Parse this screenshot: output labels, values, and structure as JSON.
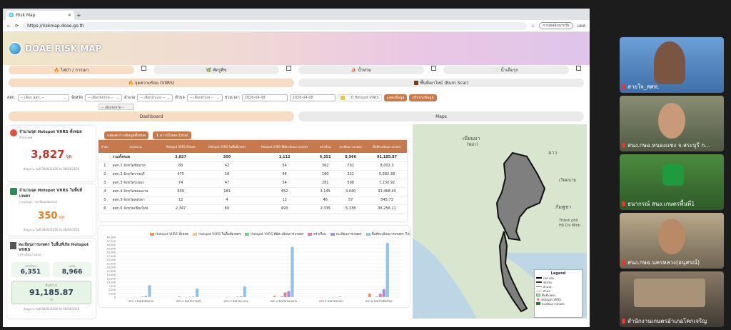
{
  "browser": {
    "tab_title": "Risk Map",
    "url": "https://riskmap.doae.go.th",
    "profile": "การเผลอิกนาถวัย",
    "other": "แหล"
  },
  "app": {
    "logo_text": "DOAE RISK MAP"
  },
  "hazard_tabs": [
    {
      "label": "🔥 ไฟป่า / การเผา"
    },
    {
      "label": "🌿 ศัตรูพืช"
    },
    {
      "label": "⛵ น้ำท่วม"
    },
    {
      "label": "🥛 น้ำเค็มรุก"
    }
  ],
  "sub_tabs": {
    "viirs": "🔥 จุดความร้อน (VIIRS)",
    "burn_scar": "พื้นที่เผาไหม้ (Burn Scar)"
  },
  "filters": {
    "office_label": "สสก.",
    "office_value": "-- เลือก สสก. --",
    "province_label": "จังหวัด",
    "province_value": "-- เลือกจังหวัด --",
    "district_label": "อำเภอ",
    "district_value": "-- เลือกอำเภอ --",
    "subdistrict_label": "ตำบล",
    "subdistrict_value": "-- เลือกตำบล --",
    "period_label": "ช่วงเวลา",
    "date_from": "2026-04-08",
    "date_to": "2026-04-08",
    "hotspot_toggle": "มี Hotspot VIIRS",
    "show_button": "แสดงข้อมูล",
    "refresh_button": "ปรับปรุงข้อมูล",
    "dropdown_option": "-- เลือกจังหวัด --"
  },
  "view_tabs": {
    "dashboard": "Dashboard",
    "maps": "Maps"
  },
  "stats": {
    "hotspot_all_title": "จำนวนจุด Hotspot VIIRS ทั้งหมด",
    "hotspot_all_sub": "ทั่วประเทศ",
    "hotspot_all_value": "3,827",
    "hotspot_all_unit": "จุด",
    "hotspot_all_note": "ข้อมูล ณ วันที่ 08/04/2026 ถึง 08/04/2026",
    "hotspot_farm_title": "จำนวนจุด Hotspot VIIRS ในพื้นที่เกษตร",
    "hotspot_farm_sub": "(ระบบปลูก / ทะเบียนเกษตรกร)",
    "hotspot_farm_value": "350",
    "hotspot_farm_unit": "จุด",
    "hotspot_farm_note": "ข้อมูล ณ วันที่ 08/04/2026 ถึง 08/04/2026",
    "farmer_title": "ทะเบียนการเกษตร ในพื้นที่เกิด Hotspot VIIRS",
    "farmer_sub": "(ครัวเรือน / แปลง)",
    "households_label": "ครัวเรือน",
    "households_value": "6,351",
    "plots_label": "แปลง",
    "plots_value": "8,966",
    "area_label": "พื้นที่ (ไร่)",
    "area_value": "91,185.87",
    "area_unit": "ไร่",
    "farmer_note": "ข้อมูล ณ วันที่ 08/04/2026 ถึง 08/04/2026"
  },
  "table": {
    "btn_show_all": "แสดงตารางข้อมูลทั้งหมด",
    "btn_export": "⬇ ดาวน์โหลด Excel",
    "headers": [
      "ลำดับ",
      "หน่วยงาน",
      "Hotspot VIIRS ทั้งหมด",
      "Hotspot VIIRS ในพื้นที่เกษตร",
      "Hotspot VIIRS ที่มีทะเบียนการเกษตร",
      "ครัวเรือน",
      "ทะเบียนการเกษตร",
      "พื้นที่ทะเบียนการเกษตร"
    ],
    "rows": [
      [
        "",
        "รวมทั้งหมด",
        "3,827",
        "350",
        "1,112",
        "6,351",
        "8,966",
        "91,185.87"
      ],
      [
        "1",
        "สสก.1 จังหวัดชัยนาท",
        "80",
        "42",
        "54",
        "362",
        "702",
        "8,002.3"
      ],
      [
        "2",
        "สสก.2 จังหวัดราชบุรี",
        "475",
        "18",
        "46",
        "180",
        "321",
        "5,682.38"
      ],
      [
        "3",
        "สสก.3 จังหวัดระยอง",
        "74",
        "47",
        "54",
        "281",
        "508",
        "7,230.92"
      ],
      [
        "4",
        "สสก.4 จังหวัดขอนแก่น",
        "839",
        "181",
        "452",
        "3,145",
        "4,040",
        "33,468.43"
      ],
      [
        "5",
        "สสก.5 จังหวัดสงขลา",
        "12",
        "4",
        "13",
        "46",
        "57",
        "545.73"
      ],
      [
        "6",
        "สสก.6 จังหวัดเชียงใหม่",
        "2,347",
        "60",
        "493",
        "2,335",
        "5,338",
        "36,256.11"
      ]
    ]
  },
  "chart_data": {
    "type": "bar",
    "categories": [
      "สสก.1 จังหวัดชัยนาท",
      "สสก.2 จังหวัดราชบุรี",
      "สสก.3 จังหวัดระยอง",
      "สสก.4 จังหวัดขอนแก่น",
      "สสก.5 จังหวัดสงขลา",
      "สสก.6 จังหวัดเชียงใหม่"
    ],
    "series": [
      {
        "name": "Hotspot VIIRS ทั้งหมด",
        "color": "#e8956b",
        "values": [
          80,
          475,
          74,
          839,
          12,
          2347
        ]
      },
      {
        "name": "Hotspot VIIRS ในพื้นที่เกษตร",
        "color": "#f2c29a",
        "values": [
          42,
          18,
          47,
          181,
          4,
          60
        ]
      },
      {
        "name": "Hotspot VIIRS ที่มีทะเบียนการเกษตร",
        "color": "#7cc59a",
        "values": [
          54,
          46,
          54,
          452,
          13,
          493
        ]
      },
      {
        "name": "ครัวเรือน",
        "color": "#e57fa0",
        "values": [
          362,
          180,
          281,
          3145,
          46,
          2335
        ]
      },
      {
        "name": "ทะเบียนการเกษตร",
        "color": "#a58fd6",
        "values": [
          702,
          321,
          508,
          4040,
          57,
          5338
        ]
      },
      {
        "name": "พื้นที่ทะเบียนการเกษตร (ไร่)",
        "color": "#8fc3ec",
        "values": [
          8002.3,
          5682.38,
          7230.92,
          33468.43,
          545.73,
          36256.11
        ]
      }
    ],
    "ylim": [
      0,
      40000
    ],
    "yticks": [
      "0",
      "2,500",
      "5,000",
      "7,500",
      "10,000",
      "12,500",
      "15,000",
      "17,500",
      "20,000",
      "22,500",
      "25,000",
      "27,500",
      "30,000",
      "32,500",
      "35,000",
      "37,500",
      "40,000"
    ],
    "grid": true,
    "legend": "top"
  },
  "map": {
    "labels": [
      "เมียนมา",
      "(พม่า)",
      "ลาว",
      "เวียดนาม",
      "กัมพูชา",
      "Thành phố",
      "Hồ Chí Minh"
    ],
    "legend_title": "Legend",
    "legend_items": [
      "เขต สสก.",
      "จังหวัด",
      "อำเภอ",
      "ตำบล",
      "พื้นที่เกษตร",
      "Hotspot VIIRS",
      "ทะเบียนการเกษตร"
    ]
  },
  "participants": [
    {
      "name": "สายใจ_สศท."
    },
    {
      "name": "สนง.กษอ.หนองแซง จ.สระบุรี ก..."
    },
    {
      "name": "ธนากรณ์ สนง.เกษตรพื้นที่1"
    },
    {
      "name": "สนง.กษอ.นครหลวง(อนุสรณ์)"
    },
    {
      "name": "สำนักงานเกษตรอำเภอโคกเจริญ"
    }
  ]
}
